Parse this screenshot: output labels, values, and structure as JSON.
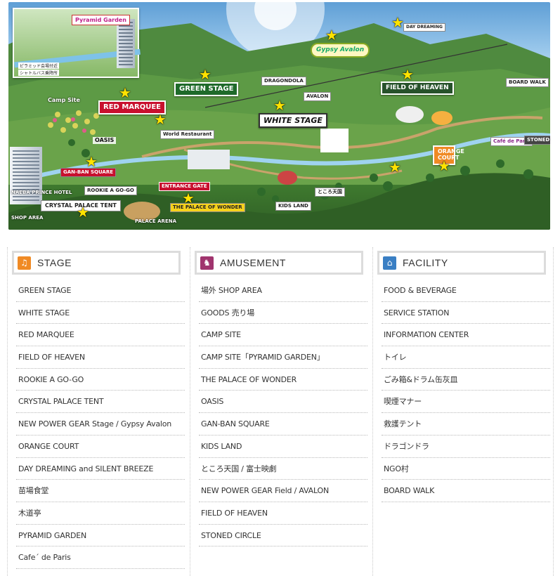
{
  "colors": {
    "stage_icon": "#f08a24",
    "amusement_icon": "#a0346e",
    "facility_icon": "#3a7fc4",
    "header_border": "#dcdcdc"
  },
  "map": {
    "inset_tag": "Pyramid Garden",
    "inset_labels": [
      "ピラミッド会場付近",
      "シャトルバス乗降所"
    ],
    "labels": {
      "green_stage": "GREEN STAGE",
      "red_marquee": "RED MARQUEE",
      "white_stage": "WHITE STAGE",
      "field_of_heaven": "FIELD OF HEAVEN",
      "avalon": "AVALON",
      "gypsy_avalon": "Gypsy Avalon",
      "dragondola": "DRAGONDOLA",
      "orange_court": "ORANGE COURT",
      "crystal_palace": "CRYSTAL PALACE TENT",
      "palace_arena": "PALACE ARENA",
      "camp_site": "Camp Site",
      "world_restaurant": "World Restaurant",
      "entrance_gate": "ENTRANCE GATE",
      "shop_area": "SHOP AREA",
      "kids_land": "KIDS LAND",
      "oasis": "OASIS",
      "naeba_prince_hotel": "NAEBA PRINCE HOTEL",
      "gan_ban": "GAN-BAN SQUARE",
      "boardwalk": "BOARD WALK",
      "day_dreaming": "DAY DREAMING",
      "cafe_de_paris": "Café de Paris",
      "tokoro_tengoku": "ところ天国",
      "stoned_circle": "STONED CIRCLE",
      "rookie": "ROOKIE A GO-GO",
      "wonder": "THE PALACE OF WONDER"
    }
  },
  "columns": [
    {
      "title": "STAGE",
      "icon": "music-note",
      "icon_glyph": "♫",
      "items": [
        "GREEN STAGE",
        "WHITE STAGE",
        "RED MARQUEE",
        "FIELD OF HEAVEN",
        "ROOKIE A GO-GO",
        "CRYSTAL PALACE TENT",
        "NEW POWER GEAR Stage / Gypsy Avalon",
        "ORANGE COURT",
        "DAY DREAMING and SILENT BREEZE",
        "苗場食堂",
        "木道亭",
        "PYRAMID GARDEN",
        "Cafe´ de Paris"
      ]
    },
    {
      "title": "AMUSEMENT",
      "icon": "rocking-horse",
      "icon_glyph": "♞",
      "items": [
        "場外 SHOP AREA",
        "GOODS 売り場",
        "CAMP SITE",
        "CAMP SITE「PYRAMID GARDEN」",
        "THE PALACE OF WONDER",
        "OASIS",
        "GAN-BAN SQUARE",
        "KIDS LAND",
        "ところ天国 / 富士映劇",
        "NEW POWER GEAR Field / AVALON",
        "FIELD OF HEAVEN",
        "STONED CIRCLE"
      ]
    },
    {
      "title": "FACILITY",
      "icon": "home",
      "icon_glyph": "⌂",
      "items": [
        "FOOD & BEVERAGE",
        "SERVICE STATION",
        "INFORMATION CENTER",
        "トイレ",
        "ごみ箱&ドラム缶灰皿",
        "喫煙マナー",
        "救護テント",
        "ドラゴンドラ",
        "NGO村",
        "BOARD WALK"
      ]
    }
  ]
}
